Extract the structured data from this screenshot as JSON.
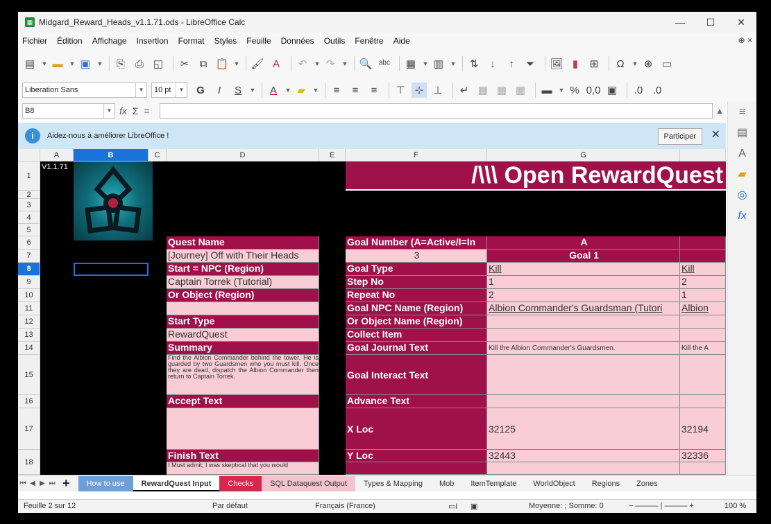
{
  "window": {
    "title": "Midgard_Reward_Heads_v1.1.71.ods - LibreOffice Calc",
    "minimize": "—",
    "maximize": "☐",
    "close": "✕"
  },
  "menu": [
    "Fichier",
    "Édition",
    "Affichage",
    "Insertion",
    "Format",
    "Styles",
    "Feuille",
    "Données",
    "Outils",
    "Fenêtre",
    "Aide"
  ],
  "menu_right": "⊕ ×",
  "toolbar": {
    "font_name": "Liberation Sans",
    "font_size": "10 pt",
    "bold": "G",
    "italic": "I",
    "underline": "S",
    "number_format": "0,0",
    "percent": "%"
  },
  "formula": {
    "name_box": "B8",
    "fx": "fx",
    "sum": "Σ",
    "equals": "="
  },
  "info": {
    "icon": "i",
    "text": "Aidez-nous à améliorer LibreOffice !",
    "button": "Participer",
    "close": "✕"
  },
  "columns": [
    "A",
    "B",
    "C",
    "D",
    "E",
    "F",
    "G"
  ],
  "rows": [
    "1",
    "2",
    "3",
    "4",
    "5",
    "6",
    "7",
    "8",
    "9",
    "10",
    "11",
    "12",
    "13",
    "14",
    "15",
    "16",
    "17",
    "18"
  ],
  "sheet": {
    "version": "V1.1.71",
    "big_title": "/\\\\\\ Open RewardQuest",
    "left": {
      "quest_name_hdr": "Quest Name",
      "quest_name": "[Journey] Off with Their Heads",
      "start_npc_hdr": "Start = NPC (Region)",
      "start_npc": "Captain Torrek (Tutorial)",
      "or_object_hdr": "Or Object (Region)",
      "or_object": "",
      "start_type_hdr": "Start Type",
      "start_type": "RewardQuest",
      "summary_hdr": "Summary",
      "summary": "Find the Albion Commander behind the tower. He is guarded by two Guardsmen who you must kill. Once they are dead, dispatch the Albion Commander then return to Captain Torrek.",
      "accept_hdr": "Accept Text",
      "accept": "",
      "finish_hdr": "Finish Text",
      "finish": "I Must admit, I was skeptical that you would"
    },
    "right": {
      "goal_number_hdr": "Goal Number (A=Active/I=In",
      "goal_number": "3",
      "goal_col_letter": "A",
      "goal_col_title": "Goal 1",
      "labels": [
        "Goal Type",
        "Step No",
        "Repeat No",
        "Goal NPC Name (Region)",
        "Or Object Name (Region)",
        "Collect Item",
        "Goal Journal Text",
        "Goal Interact Text",
        "Advance Text",
        "X Loc",
        "Y Loc"
      ],
      "goal1": [
        "Kill",
        "1",
        "2",
        "Albion Commander's Guardsman (Tutori",
        "",
        "",
        "Kill the Albion Commander's Guardsmen.",
        "",
        "",
        "32125",
        "32443"
      ],
      "goal2": [
        "Kill",
        "2",
        "1",
        "Albion",
        "",
        "",
        "Kill the A",
        "",
        "",
        "32194",
        "32336"
      ]
    }
  },
  "tabs": [
    "How to use",
    "RewardQuest Input",
    "Checks",
    "SQL Dataquest Output",
    "Types & Mapping",
    "Mob",
    "ItemTemplate",
    "WorldObject",
    "Regions",
    "Zones"
  ],
  "active_tab": "RewardQuest Input",
  "status": {
    "sheet": "Feuille 2 sur 12",
    "style": "Par défaut",
    "lang": "Français (France)",
    "summary": "Moyenne: ; Somme: 0",
    "zoom": "100 %"
  }
}
